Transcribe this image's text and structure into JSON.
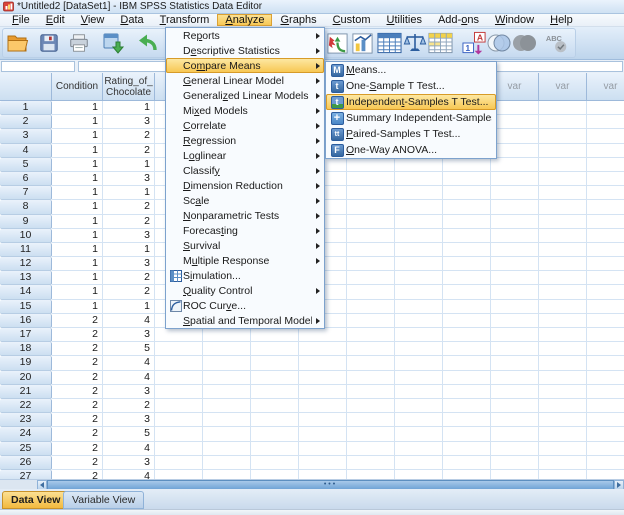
{
  "window": {
    "title": "*Untitled2 [DataSet1] - IBM SPSS Statistics Data Editor"
  },
  "menubar": {
    "items": [
      {
        "label": "File",
        "u": 0
      },
      {
        "label": "Edit",
        "u": 0
      },
      {
        "label": "View",
        "u": 0
      },
      {
        "label": "Data",
        "u": 0
      },
      {
        "label": "Transform",
        "u": 0
      },
      {
        "label": "Analyze",
        "u": 0,
        "active": true
      },
      {
        "label": "Graphs",
        "u": 0
      },
      {
        "label": "Custom",
        "u": 0
      },
      {
        "label": "Utilities",
        "u": 0
      },
      {
        "label": "Add-ons",
        "u": 4
      },
      {
        "label": "Window",
        "u": 0
      },
      {
        "label": "Help",
        "u": 0
      }
    ]
  },
  "toolbar": {
    "buttons": [
      {
        "name": "open-data-icon",
        "icon": "folder"
      },
      {
        "name": "save-icon",
        "icon": "floppy"
      },
      {
        "name": "print-icon",
        "icon": "printer"
      },
      {
        "name": "recall-dialogs-icon",
        "icon": "recall"
      },
      {
        "name": "undo-icon",
        "icon": "undo"
      },
      {
        "name": "redo-icon",
        "icon": "redo"
      },
      {
        "name": "goto-case-icon",
        "icon": "chartred"
      },
      {
        "name": "goto-variable-icon",
        "icon": "chartblue"
      },
      {
        "name": "variables-icon",
        "icon": "gridblue"
      },
      {
        "name": "weight-cases-icon",
        "icon": "scales"
      },
      {
        "name": "split-file-icon",
        "icon": "gridyellow"
      },
      {
        "name": "value-labels-icon",
        "icon": "valuelabels"
      },
      {
        "name": "use-sets-icon",
        "icon": "venn"
      },
      {
        "name": "select-cases-icon",
        "icon": "graycircles"
      },
      {
        "name": "spell-check-icon",
        "icon": "abc"
      }
    ]
  },
  "analyze_menu": {
    "items": [
      {
        "label": "Reports",
        "u": 2,
        "arrow": true
      },
      {
        "label": "Descriptive Statistics",
        "u": 1,
        "arrow": true
      },
      {
        "label": "Compare Means",
        "u": 2,
        "arrow": true,
        "highlight": true
      },
      {
        "label": "General Linear Model",
        "u": 0,
        "arrow": true
      },
      {
        "label": "Generalized Linear Models",
        "u": 8,
        "arrow": true
      },
      {
        "label": "Mixed Models",
        "u": 2,
        "arrow": true
      },
      {
        "label": "Correlate",
        "u": 0,
        "arrow": true
      },
      {
        "label": "Regression",
        "u": 0,
        "arrow": true
      },
      {
        "label": "Loglinear",
        "u": 1,
        "arrow": true
      },
      {
        "label": "Classify",
        "u": 7,
        "arrow": true
      },
      {
        "label": "Dimension Reduction",
        "u": 0,
        "arrow": true
      },
      {
        "label": "Scale",
        "u": 2,
        "arrow": true
      },
      {
        "label": "Nonparametric Tests",
        "u": 0,
        "arrow": true
      },
      {
        "label": "Forecasting",
        "u": 7,
        "arrow": true
      },
      {
        "label": "Survival",
        "u": 0,
        "arrow": true
      },
      {
        "label": "Multiple Response",
        "u": 1,
        "arrow": true
      },
      {
        "label": "Simulation...",
        "u": 1,
        "arrow": false,
        "icon": "sim"
      },
      {
        "label": "Quality Control",
        "u": 0,
        "arrow": true
      },
      {
        "label": "ROC Curve...",
        "u": 7,
        "arrow": false,
        "icon": "roc"
      },
      {
        "label": "Spatial and Temporal Modeling...",
        "u": 0,
        "arrow": true
      }
    ]
  },
  "compare_means_submenu": {
    "items": [
      {
        "label": "Means...",
        "u": 0,
        "icon": "M"
      },
      {
        "label": "One-Sample T Test...",
        "u": 4,
        "icon": "t1"
      },
      {
        "label": "Independent-Samples T Test...",
        "u": 10,
        "icon": "t2",
        "highlight": true
      },
      {
        "label": "Summary Independent-Samples T Test",
        "u": -1,
        "icon": "plus"
      },
      {
        "label": "Paired-Samples T Test...",
        "u": 0,
        "icon": "tt"
      },
      {
        "label": "One-Way ANOVA...",
        "u": 0,
        "icon": "F"
      }
    ]
  },
  "grid": {
    "col_headers": [
      "",
      "Condition",
      "Rating_of_Chocolate"
    ],
    "var_header": "var",
    "rows": [
      {
        "n": 1,
        "condition": 1,
        "rating": 1
      },
      {
        "n": 2,
        "condition": 1,
        "rating": 3
      },
      {
        "n": 3,
        "condition": 1,
        "rating": 2
      },
      {
        "n": 4,
        "condition": 1,
        "rating": 2
      },
      {
        "n": 5,
        "condition": 1,
        "rating": 1
      },
      {
        "n": 6,
        "condition": 1,
        "rating": 3
      },
      {
        "n": 7,
        "condition": 1,
        "rating": 1
      },
      {
        "n": 8,
        "condition": 1,
        "rating": 2
      },
      {
        "n": 9,
        "condition": 1,
        "rating": 2
      },
      {
        "n": 10,
        "condition": 1,
        "rating": 3
      },
      {
        "n": 11,
        "condition": 1,
        "rating": 1
      },
      {
        "n": 12,
        "condition": 1,
        "rating": 3
      },
      {
        "n": 13,
        "condition": 1,
        "rating": 2
      },
      {
        "n": 14,
        "condition": 1,
        "rating": 2
      },
      {
        "n": 15,
        "condition": 1,
        "rating": 1
      },
      {
        "n": 16,
        "condition": 2,
        "rating": 4
      },
      {
        "n": 17,
        "condition": 2,
        "rating": 3
      },
      {
        "n": 18,
        "condition": 2,
        "rating": 5
      },
      {
        "n": 19,
        "condition": 2,
        "rating": 4
      },
      {
        "n": 20,
        "condition": 2,
        "rating": 4
      },
      {
        "n": 21,
        "condition": 2,
        "rating": 3
      },
      {
        "n": 22,
        "condition": 2,
        "rating": 2
      },
      {
        "n": 23,
        "condition": 2,
        "rating": 3
      },
      {
        "n": 24,
        "condition": 2,
        "rating": 5
      },
      {
        "n": 25,
        "condition": 2,
        "rating": 4
      },
      {
        "n": 26,
        "condition": 2,
        "rating": 3
      },
      {
        "n": 27,
        "condition": 2,
        "rating": 4
      }
    ]
  },
  "tabs": {
    "data_view": "Data View",
    "variable_view": "Variable View"
  },
  "colors": {
    "highlight_gold": "#f7c54e",
    "menu_border": "#7da2cd",
    "grid_line": "#d4e3f3",
    "header_blue": "#ccdff1",
    "accent_blue": "#35679f"
  }
}
